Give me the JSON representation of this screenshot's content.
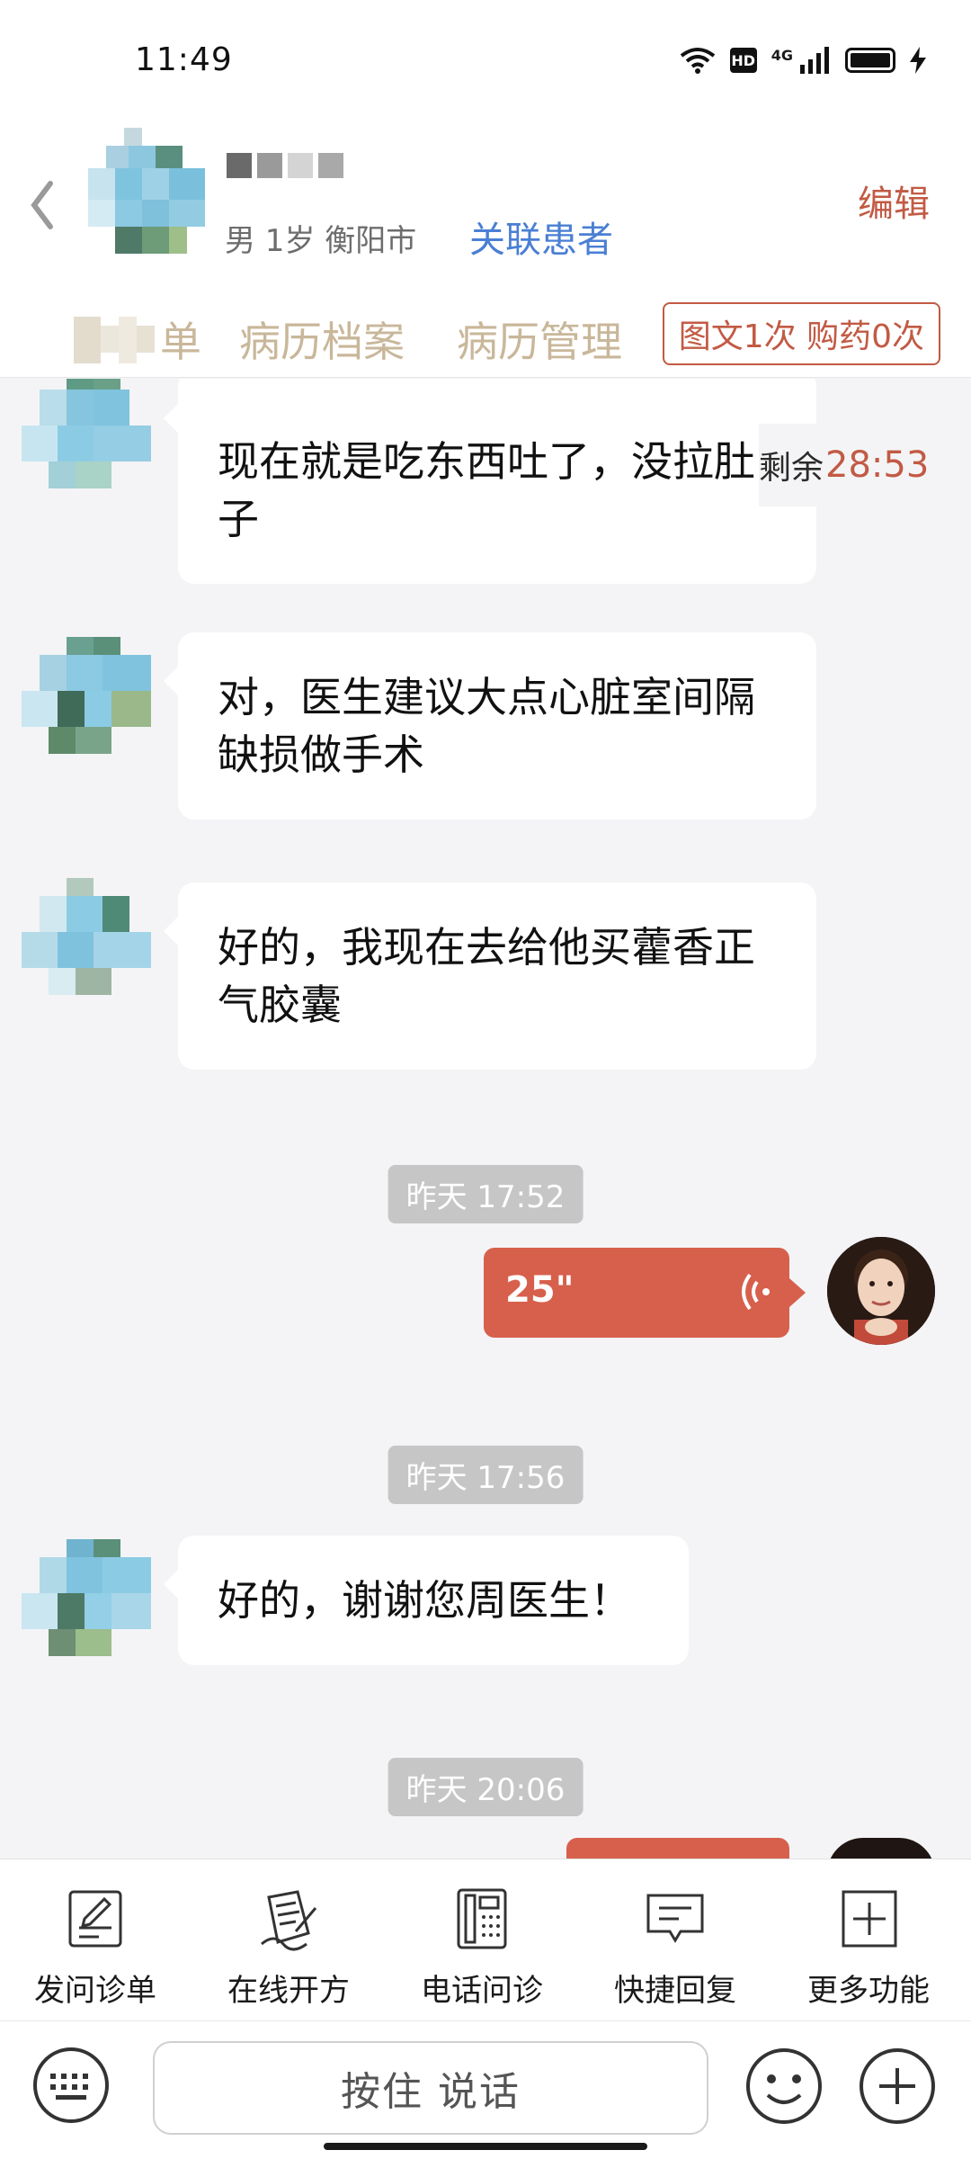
{
  "status_bar": {
    "time": "11:49",
    "hd": "HD",
    "network": "4G"
  },
  "header": {
    "patient_info": "男 1岁  衡阳市",
    "link_patient": "关联患者",
    "edit": "编辑",
    "tabs": [
      "单",
      "病历档案",
      "病历管理"
    ],
    "quota": "图文1次 购药0次"
  },
  "countdown": {
    "label": "剩余",
    "value": "28:53"
  },
  "messages": [
    {
      "text": "现在就是吃东西吐了，没拉肚子"
    },
    {
      "text": "对，医生建议大点心脏室间隔缺损做手术"
    },
    {
      "text": "好的，我现在去给他买藿香正气胶囊"
    },
    {
      "timestamp": "昨天 17:52"
    },
    {
      "voice_duration": "25\""
    },
    {
      "timestamp": "昨天 17:56"
    },
    {
      "text": "好的，谢谢您周医生！"
    },
    {
      "timestamp": "昨天 20:06"
    }
  ],
  "toolbar": [
    {
      "label": "发问诊单",
      "icon": "form-edit-icon"
    },
    {
      "label": "在线开方",
      "icon": "prescription-icon"
    },
    {
      "label": "电话问诊",
      "icon": "phone-icon"
    },
    {
      "label": "快捷回复",
      "icon": "quick-reply-icon"
    },
    {
      "label": "更多功能",
      "icon": "more-plus-icon"
    }
  ],
  "input": {
    "hold_to_talk": "按住 说话"
  },
  "colors": {
    "accent": "#c25a44",
    "voice_bubble": "#d7604c",
    "link": "#4a7fd4",
    "tab_text": "#c9b79a"
  }
}
